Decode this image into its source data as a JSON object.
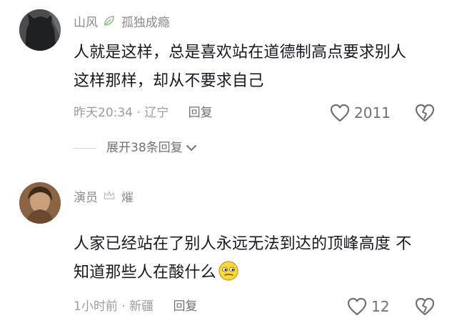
{
  "comments": [
    {
      "username": "山风",
      "username_suffix": "孤独成瘾",
      "text_line1": "人就是这样，总是喜欢站在道德制高点要求别人",
      "text_line2": "这样那样，却从不要求自己",
      "time_location": "昨天20:34 · 辽宁",
      "reply_label": "回复",
      "like_count": "2011",
      "expand_label": "展开38条回复"
    },
    {
      "username": "演员",
      "username_suffix": "熣",
      "text_line1": "人家已经站在了别人永远无法到达的顶峰高度  不",
      "text_line2": "知道那些人在酸什么",
      "time_location": "1小时前 · 新疆",
      "reply_label": "回复",
      "like_count": "12"
    }
  ],
  "icons": {
    "like": "heart-outline-icon",
    "dislike": "broken-heart-icon",
    "expand": "chevron-down-icon",
    "emoji": "smirk-emoji-icon",
    "badge1": "leaf-badge-icon",
    "badge2": "crown-badge-icon"
  },
  "colors": {
    "text": "#161823",
    "muted": "#9a9ba1",
    "secondary": "#6f7077"
  }
}
